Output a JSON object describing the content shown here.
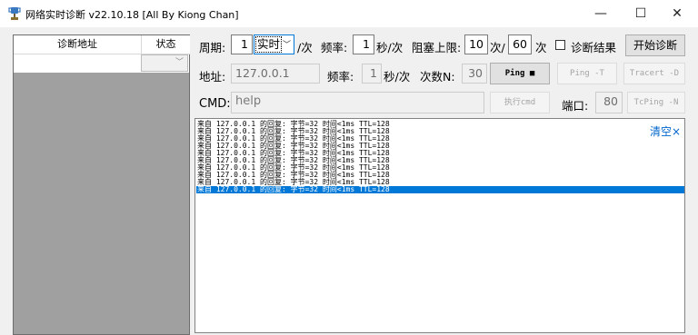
{
  "window": {
    "title": "网络实时诊断 v22.10.18 [All By Kiong Chan]",
    "minimize": "—",
    "maximize": "☐",
    "close": "✕"
  },
  "left_panel": {
    "columns": [
      "诊断地址",
      "状态"
    ],
    "combo_arrow": "﹀"
  },
  "row1": {
    "period_label": "周期:",
    "period_value": "1",
    "mode_value": "实时",
    "mode_arrow": "﹀",
    "per_label": "/次",
    "freq_label": "频率:",
    "freq_value": "1",
    "freq_unit": "秒/次",
    "block_label": "阻塞上限:",
    "block_value": "10",
    "block_unit": "次/",
    "block_value2": "60",
    "block_unit2": "次",
    "result_checked": false,
    "result_label": "诊断结果",
    "start_button": "开始诊断"
  },
  "row2": {
    "address_label": "地址:",
    "address_value": "127.0.0.1",
    "freq_label": "频率:",
    "freq_value": "1",
    "freq_unit": "秒/次",
    "count_label": "次数N:",
    "count_value": "30",
    "ping_button": "Ping ■",
    "ping_t_button": "Ping -T",
    "tracert_button": "Tracert -D"
  },
  "row3": {
    "cmd_label": "CMD:",
    "cmd_placeholder": "help",
    "exec_button": "执行cmd",
    "port_label": "端口:",
    "port_value": "80",
    "tcping_button": "TcPing -N"
  },
  "log": {
    "clear_label": "清空×",
    "lines": [
      "来自 127.0.0.1 的回复: 字节=32 时间<1ms TTL=128",
      "来自 127.0.0.1 的回复: 字节=32 时间<1ms TTL=128",
      "来自 127.0.0.1 的回复: 字节=32 时间<1ms TTL=128",
      "来自 127.0.0.1 的回复: 字节=32 时间<1ms TTL=128",
      "来自 127.0.0.1 的回复: 字节=32 时间<1ms TTL=128",
      "来自 127.0.0.1 的回复: 字节=32 时间<1ms TTL=128",
      "来自 127.0.0.1 的回复: 字节=32 时间<1ms TTL=128",
      "来自 127.0.0.1 的回复: 字节=32 时间<1ms TTL=128",
      "来自 127.0.0.1 的回复: 字节=32 时间<1ms TTL=128",
      "来自 127.0.0.1 的回复: 字节=32 时间<1ms TTL=128"
    ],
    "selected_index": 9
  },
  "colors": {
    "selection": "#0078d7",
    "link": "#0066cc"
  }
}
